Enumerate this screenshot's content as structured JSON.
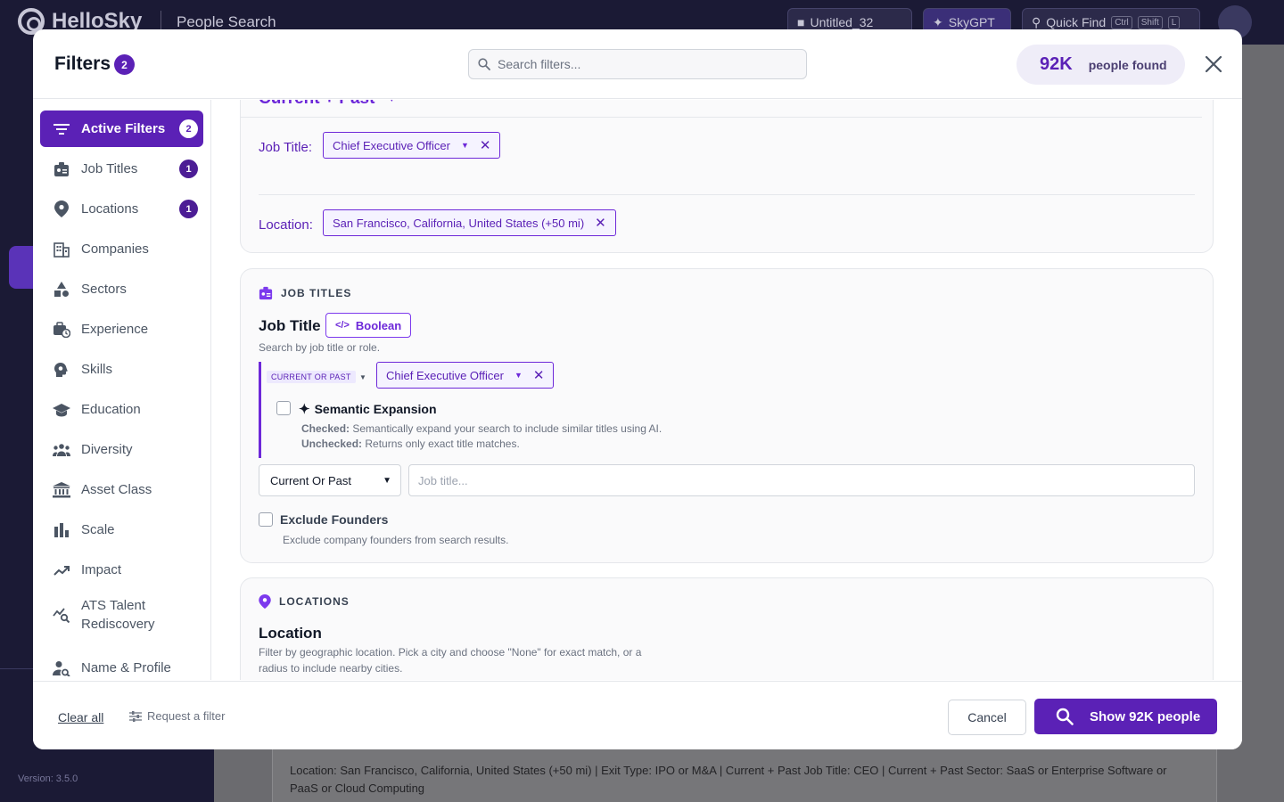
{
  "background": {
    "logo_text": "HelloSky",
    "page_title": "People Search",
    "project_label": "Untitled_32",
    "skygpt_label": "SkyGPT",
    "quick_find_label": "Quick Find",
    "kbd": [
      "Ctrl",
      "Shift",
      "L"
    ],
    "version": "Version: 3.5.0",
    "summary": "Location: San Francisco, California, United States (+50 mi) | Exit Type: IPO or M&A | Current + Past Job Title: CEO | Current + Past Sector: SaaS or Enterprise Software or PaaS or Cloud Computing"
  },
  "modal": {
    "title": "Filters",
    "title_badge": "2",
    "search_placeholder": "Search filters...",
    "result_count": "92K",
    "result_label": "people found"
  },
  "nav": {
    "items": [
      {
        "label": "Active Filters",
        "badge": "2",
        "icon": "filter-lines-icon"
      },
      {
        "label": "Job Titles",
        "badge": "1",
        "icon": "id-badge-icon"
      },
      {
        "label": "Locations",
        "badge": "1",
        "icon": "map-pin-icon"
      },
      {
        "label": "Companies",
        "icon": "building-icon"
      },
      {
        "label": "Sectors",
        "icon": "shapes-icon"
      },
      {
        "label": "Experience",
        "icon": "briefcase-clock-icon"
      },
      {
        "label": "Skills",
        "icon": "head-gear-icon"
      },
      {
        "label": "Education",
        "icon": "graduation-cap-icon"
      },
      {
        "label": "Diversity",
        "icon": "people-group-icon"
      },
      {
        "label": "Asset Class",
        "icon": "bank-icon"
      },
      {
        "label": "Scale",
        "icon": "bar-chart-icon"
      },
      {
        "label": "Impact",
        "icon": "trend-up-icon"
      },
      {
        "label": "ATS Talent Rediscovery",
        "icon": "chart-search-icon"
      },
      {
        "label": "Name & Profile",
        "icon": "person-search-icon"
      }
    ]
  },
  "active_filters": {
    "scope_label": "Current + Past",
    "job_title_label": "Job Title:",
    "job_title_value": "Chief Executive Officer",
    "location_label": "Location:",
    "location_value": "San Francisco, California, United States (+50 mi)"
  },
  "job_titles_section": {
    "header": "JOB TITLES",
    "field_title": "Job Title",
    "boolean_label": "Boolean",
    "hint": "Search by job title or role.",
    "scope_badge": "CURRENT OR PAST",
    "selected_title": "Chief Executive Officer",
    "semantic_title": "Semantic Expansion",
    "semantic_checked_label": "Checked:",
    "semantic_checked_text": "Semantically expand your search to include similar titles using AI.",
    "semantic_unchecked_label": "Unchecked:",
    "semantic_unchecked_text": "Returns only exact title matches.",
    "scope_select_value": "Current Or Past",
    "input_placeholder": "Job title...",
    "exclude_title": "Exclude Founders",
    "exclude_hint": "Exclude company founders from search results."
  },
  "locations_section": {
    "header": "LOCATIONS",
    "field_title": "Location",
    "hint_line1": "Filter by geographic location. Pick a city and choose \"None\" for exact match, or a",
    "hint_line2": "radius to include nearby cities."
  },
  "footer": {
    "clear_all": "Clear all",
    "request_filter": "Request a filter",
    "cancel": "Cancel",
    "show_button": "Show 92K people"
  },
  "colors": {
    "accent": "#5b21b6",
    "accent_light": "#f5f3ff",
    "backdrop": "#1b1a35"
  }
}
